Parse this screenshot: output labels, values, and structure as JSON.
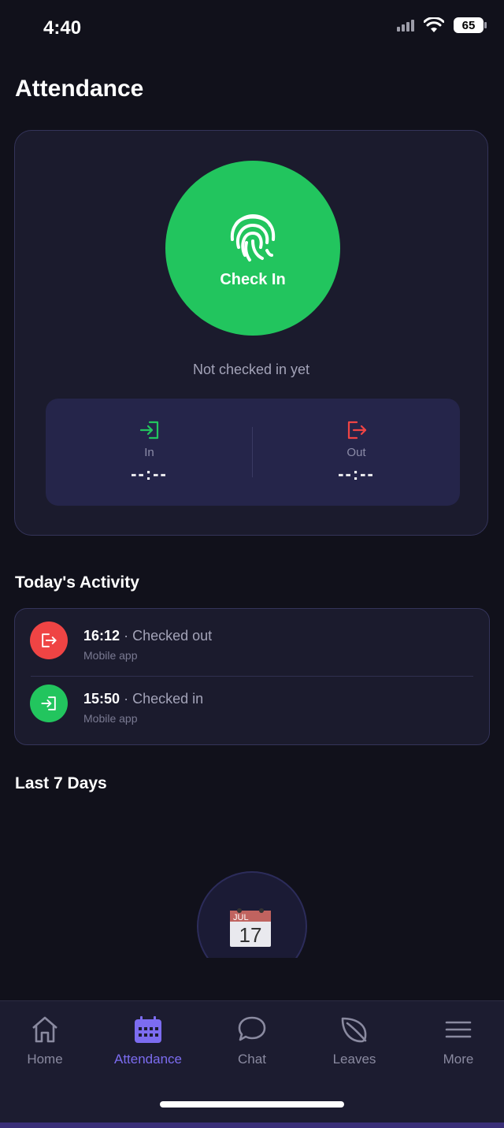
{
  "status_bar": {
    "time": "4:40",
    "battery": "65"
  },
  "page": {
    "title": "Attendance"
  },
  "checkin": {
    "button_label": "Check In",
    "status_text": "Not checked in yet",
    "in_label": "In",
    "in_value": "--:--",
    "out_label": "Out",
    "out_value": "--:--"
  },
  "activity": {
    "title": "Today's Activity",
    "items": [
      {
        "time": "16:12",
        "separator": "·",
        "status": "Checked out",
        "source": "Mobile app",
        "kind": "out"
      },
      {
        "time": "15:50",
        "separator": "·",
        "status": "Checked in",
        "source": "Mobile app",
        "kind": "in"
      }
    ]
  },
  "last7": {
    "title": "Last 7 Days",
    "calendar_month": "JUL",
    "calendar_day": "17"
  },
  "tabs": [
    {
      "label": "Home",
      "icon": "home-icon",
      "active": false
    },
    {
      "label": "Attendance",
      "icon": "calendar-icon",
      "active": true
    },
    {
      "label": "Chat",
      "icon": "chat-bubble-icon",
      "active": false
    },
    {
      "label": "Leaves",
      "icon": "leaf-icon",
      "active": false
    },
    {
      "label": "More",
      "icon": "menu-icon",
      "active": false
    }
  ],
  "colors": {
    "accent": "#7c6cf0",
    "success": "#22c55e",
    "danger": "#ef4444",
    "background": "#11111b",
    "card": "#1b1b2d"
  }
}
